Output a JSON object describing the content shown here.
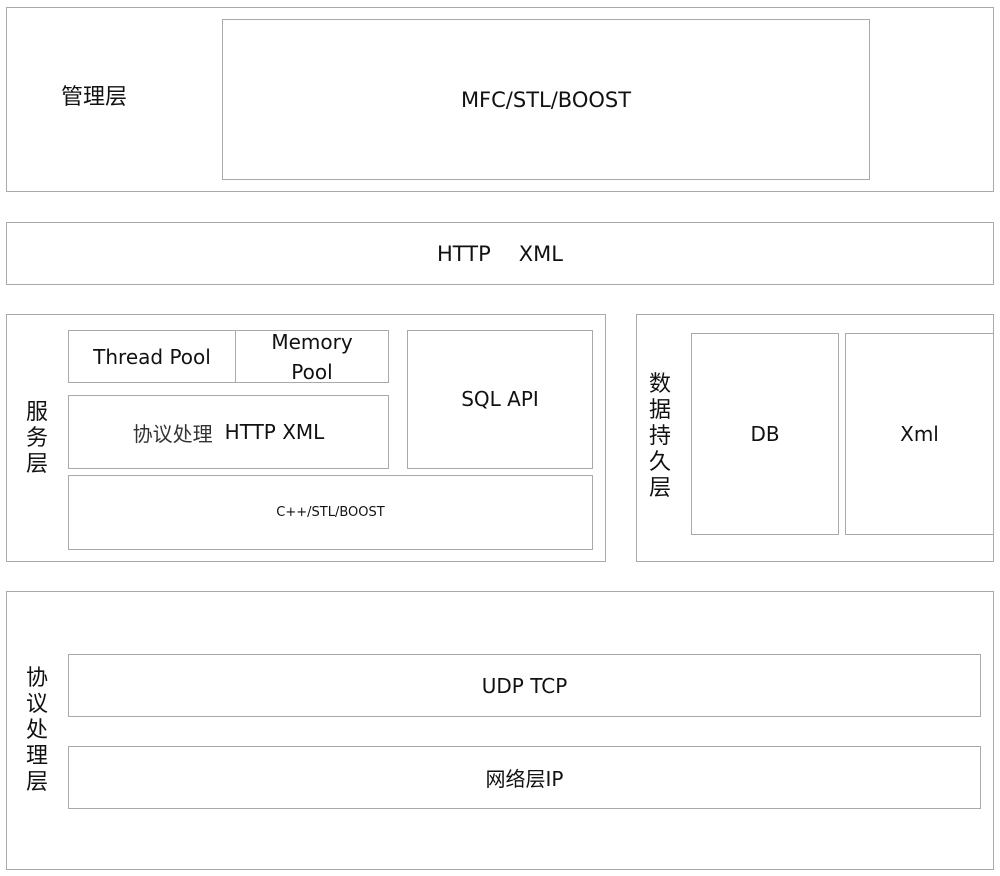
{
  "management_layer": {
    "label": "管理层",
    "content": "MFC/STL/BOOST"
  },
  "transport_bar": {
    "items": [
      "HTTP",
      "XML"
    ]
  },
  "service_layer": {
    "label": "服务层",
    "thread_pool": "Thread Pool",
    "memory_pool_line1": "Memory",
    "memory_pool_line2": "Pool",
    "protocol_processing_cn": "协议处理",
    "protocol_processing_en": "HTTP XML",
    "sql_api": "SQL API",
    "base_libs": "C++/STL/BOOST"
  },
  "persistence_layer": {
    "label": "数据持久层",
    "db": "DB",
    "xml": "Xml"
  },
  "protocol_layer": {
    "label": "协议处理层",
    "transport": "UDP TCP",
    "network": "网络层IP"
  }
}
